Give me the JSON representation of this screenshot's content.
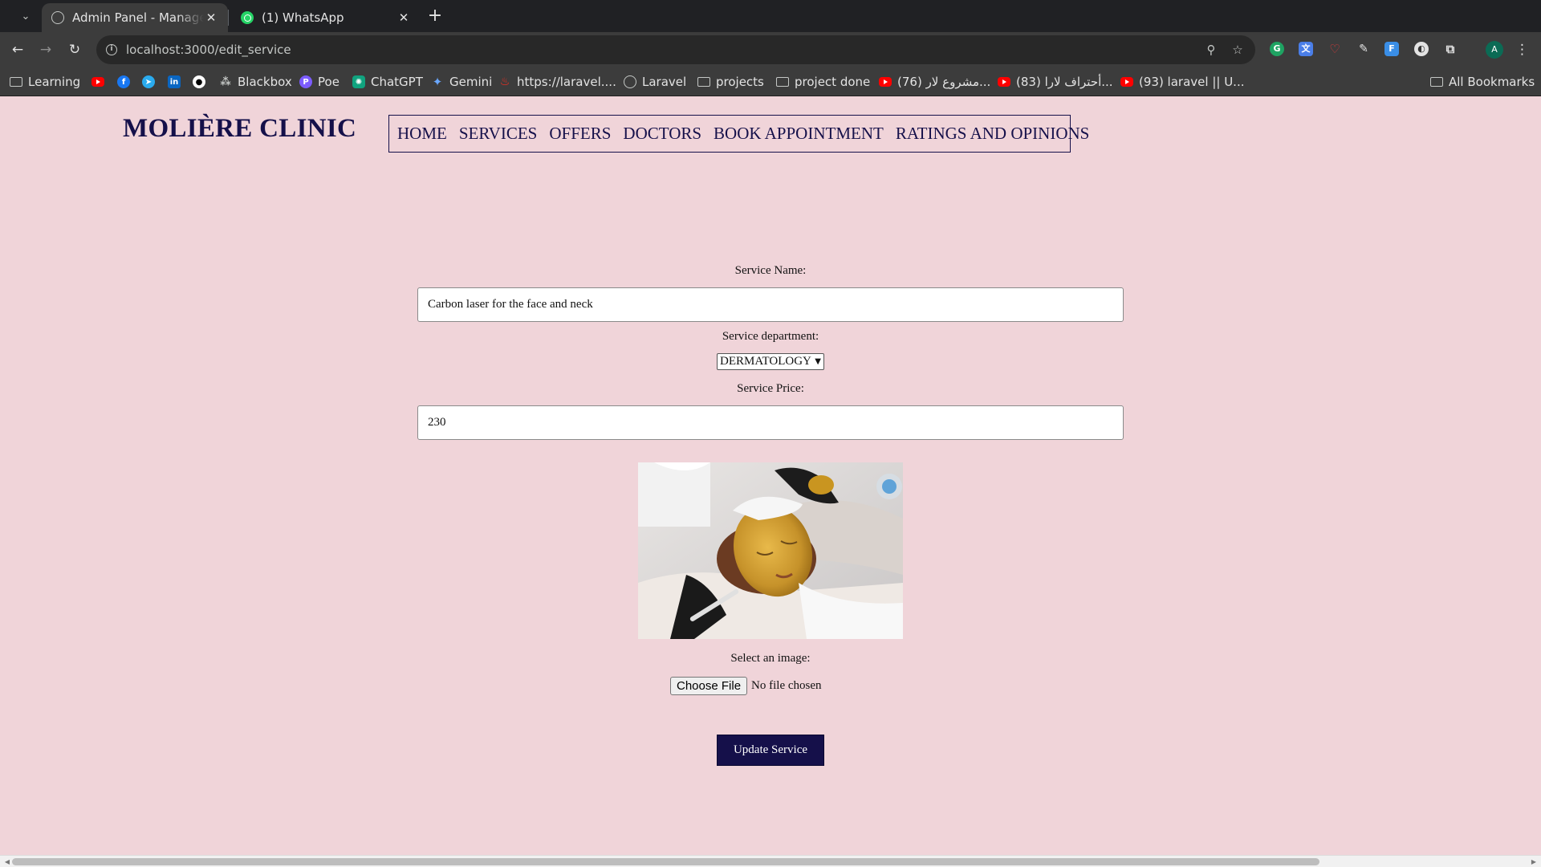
{
  "browser": {
    "tabs": [
      {
        "title": "Admin Panel - Manage Se",
        "active": true,
        "icon": "globe-icon"
      },
      {
        "title": "(1) WhatsApp",
        "active": false,
        "icon": "whatsapp-icon"
      }
    ],
    "close_glyph": "✕",
    "new_tab_glyph": "+",
    "url": "localhost:3000/edit_service",
    "bookmarks": [
      {
        "label": "Learning",
        "icon": "folder-icon"
      },
      {
        "label": "",
        "icon": "youtube-icon"
      },
      {
        "label": "",
        "icon": "facebook-icon"
      },
      {
        "label": "",
        "icon": "telegram-icon"
      },
      {
        "label": "",
        "icon": "linkedin-icon"
      },
      {
        "label": "",
        "icon": "github-icon"
      },
      {
        "label": "Blackbox",
        "icon": "blackbox-icon"
      },
      {
        "label": "Poe",
        "icon": "poe-icon"
      },
      {
        "label": "ChatGPT",
        "icon": "chatgpt-icon"
      },
      {
        "label": "Gemini",
        "icon": "gemini-icon"
      },
      {
        "label": "https://laravel....",
        "icon": "laravel-icon"
      },
      {
        "label": "Laravel",
        "icon": "globe-icon"
      },
      {
        "label": "projects",
        "icon": "folder-icon"
      },
      {
        "label": "project done",
        "icon": "folder-icon"
      },
      {
        "label": "(76) مشروع لار...",
        "icon": "youtube-icon"
      },
      {
        "label": "(83) أحتراف لارا...",
        "icon": "youtube-icon"
      },
      {
        "label": "(93) laravel || U...",
        "icon": "youtube-icon"
      }
    ],
    "all_bookmarks": "All Bookmarks",
    "profile_initial": "A"
  },
  "site": {
    "brand": "MOLIÈRE CLINIC",
    "nav": [
      "HOME",
      "SERVICES",
      "OFFERS",
      "DOCTORS",
      "BOOK APPOINTMENT",
      "RATINGS AND OPINIONS"
    ]
  },
  "form": {
    "name_label": "Service Name:",
    "name_value": "Carbon laser for the face and neck",
    "department_label": "Service department:",
    "department_value": "DERMATOLOGY",
    "price_label": "Service Price:",
    "price_value": "230",
    "image_label": "Select an image:",
    "file_button": "Choose File",
    "file_status": "No file chosen",
    "submit": "Update Service"
  },
  "colors": {
    "page_bg": "#f0d4d9",
    "brand": "#15104a",
    "button_bg": "#15104a"
  }
}
